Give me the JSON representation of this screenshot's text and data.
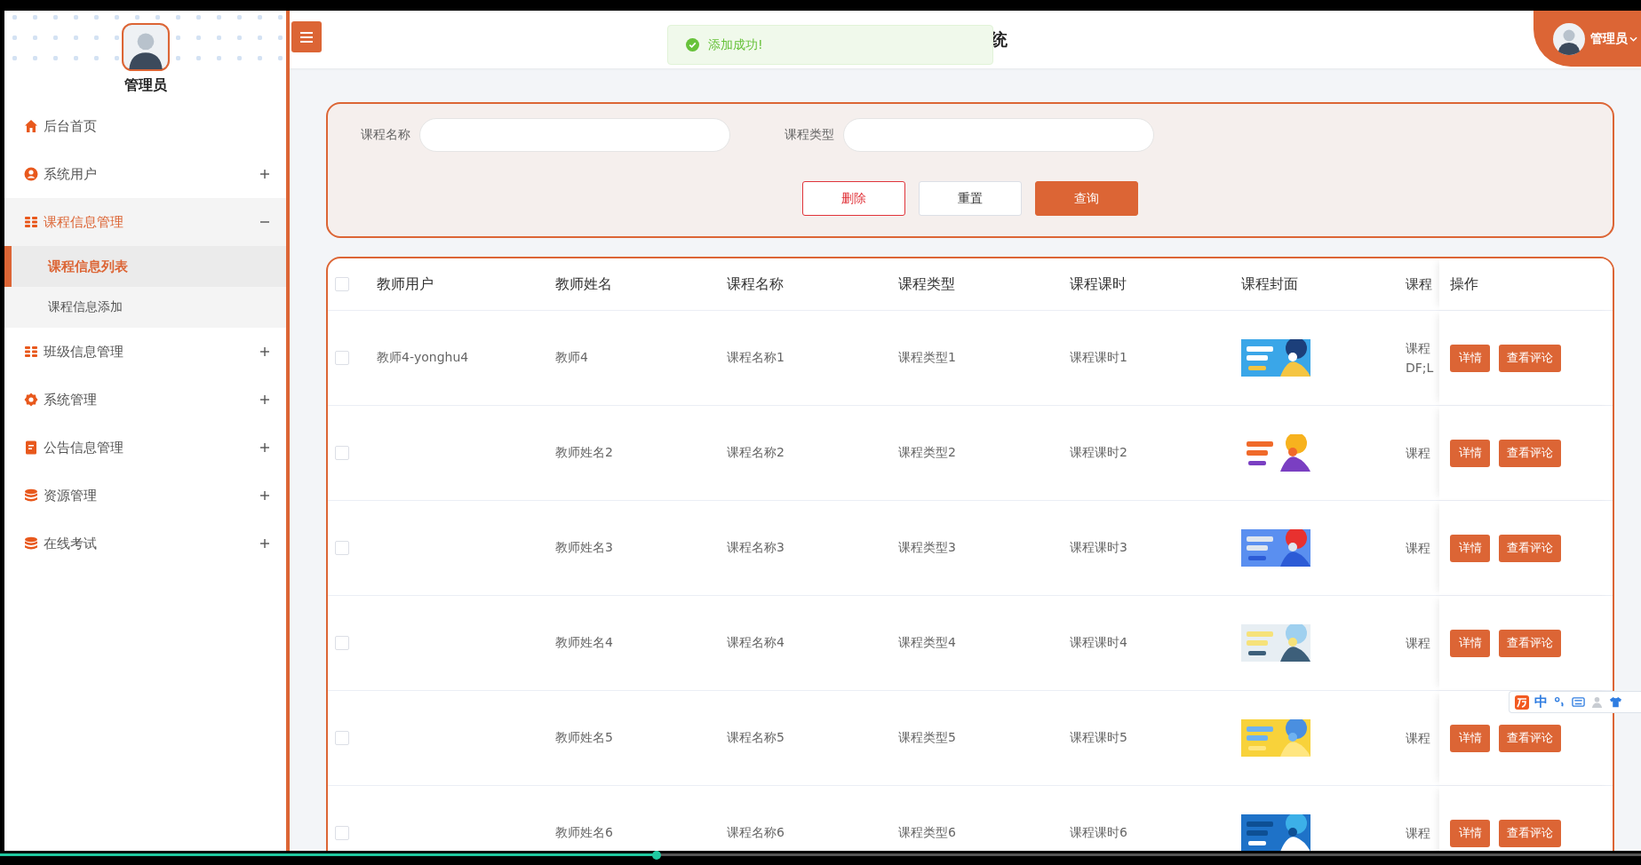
{
  "sidebar": {
    "user": "管理员",
    "items": [
      {
        "label": "后台首页",
        "kind": "link",
        "selected": false
      },
      {
        "label": "系统用户",
        "kind": "group",
        "expanded": false,
        "selected": false
      },
      {
        "label": "课程信息管理",
        "kind": "group",
        "expanded": true,
        "selected": true,
        "children": [
          {
            "label": "课程信息列表",
            "selected": true
          },
          {
            "label": "课程信息添加",
            "selected": false
          }
        ]
      },
      {
        "label": "班级信息管理",
        "kind": "group",
        "expanded": false,
        "selected": false
      },
      {
        "label": "系统管理",
        "kind": "group",
        "expanded": false,
        "selected": false
      },
      {
        "label": "公告信息管理",
        "kind": "group",
        "expanded": false,
        "selected": false
      },
      {
        "label": "资源管理",
        "kind": "group",
        "expanded": false,
        "selected": false
      },
      {
        "label": "在线考试",
        "kind": "group",
        "expanded": false,
        "selected": false
      }
    ]
  },
  "header": {
    "title": "统",
    "toast": "添加成功!",
    "user": "管理员"
  },
  "search": {
    "fields": [
      {
        "label": "课程名称"
      },
      {
        "label": "课程类型"
      }
    ],
    "buttons": [
      {
        "label": "删除",
        "kind": "danger"
      },
      {
        "label": "重置",
        "kind": "plain"
      },
      {
        "label": "查询",
        "kind": "primary"
      }
    ]
  },
  "table": {
    "header_checked": false,
    "columns": [
      "教师用户",
      "教师姓名",
      "课程名称",
      "课程类型",
      "课程课时",
      "课程封面",
      "课程",
      "操作"
    ],
    "rows": [
      {
        "checked": false,
        "teacher_user": "教师4-yonghu4",
        "teacher_name": "教师4",
        "course_name": "课程名称1",
        "course_type": "课程类型1",
        "course_hours": "课程课时1",
        "cover": {
          "kind": "picture"
        },
        "column_7": [
          "课程",
          "DF;L"
        ],
        "actions": [
          "详情",
          "查看评论"
        ]
      },
      {
        "checked": false,
        "teacher_name": "教师姓名2",
        "course_name": "课程名称2",
        "course_type": "课程类型2",
        "course_hours": "课程课时2",
        "cover": {
          "kind": "picture"
        },
        "column_7": [
          "课程"
        ],
        "actions": [
          "详情",
          "查看评论"
        ]
      },
      {
        "checked": false,
        "teacher_name": "教师姓名3",
        "course_name": "课程名称3",
        "course_type": "课程类型3",
        "course_hours": "课程课时3",
        "cover": {
          "kind": "picture"
        },
        "column_7": [
          "课程"
        ],
        "actions": [
          "详情",
          "查看评论"
        ]
      },
      {
        "checked": false,
        "teacher_name": "教师姓名4",
        "course_name": "课程名称4",
        "course_type": "课程类型4",
        "course_hours": "课程课时4",
        "cover": {
          "kind": "picture"
        },
        "column_7": [
          "课程"
        ],
        "actions": [
          "详情",
          "查看评论"
        ]
      },
      {
        "checked": false,
        "teacher_name": "教师姓名5",
        "course_name": "课程名称5",
        "course_type": "课程类型5",
        "course_hours": "课程课时5",
        "cover": {
          "kind": "picture"
        },
        "column_7": [
          "课程"
        ],
        "actions": [
          "详情",
          "查看评论"
        ]
      },
      {
        "checked": false,
        "teacher_name": "教师姓名6",
        "course_name": "课程名称6",
        "course_type": "课程类型6",
        "course_hours": "课程课时6",
        "cover": {
          "kind": "picture"
        },
        "column_7": [
          "课程"
        ],
        "actions": [
          "详情",
          "查看评论"
        ]
      }
    ]
  },
  "ime": {
    "mode": "中"
  },
  "player": {
    "level": 0.4
  }
}
